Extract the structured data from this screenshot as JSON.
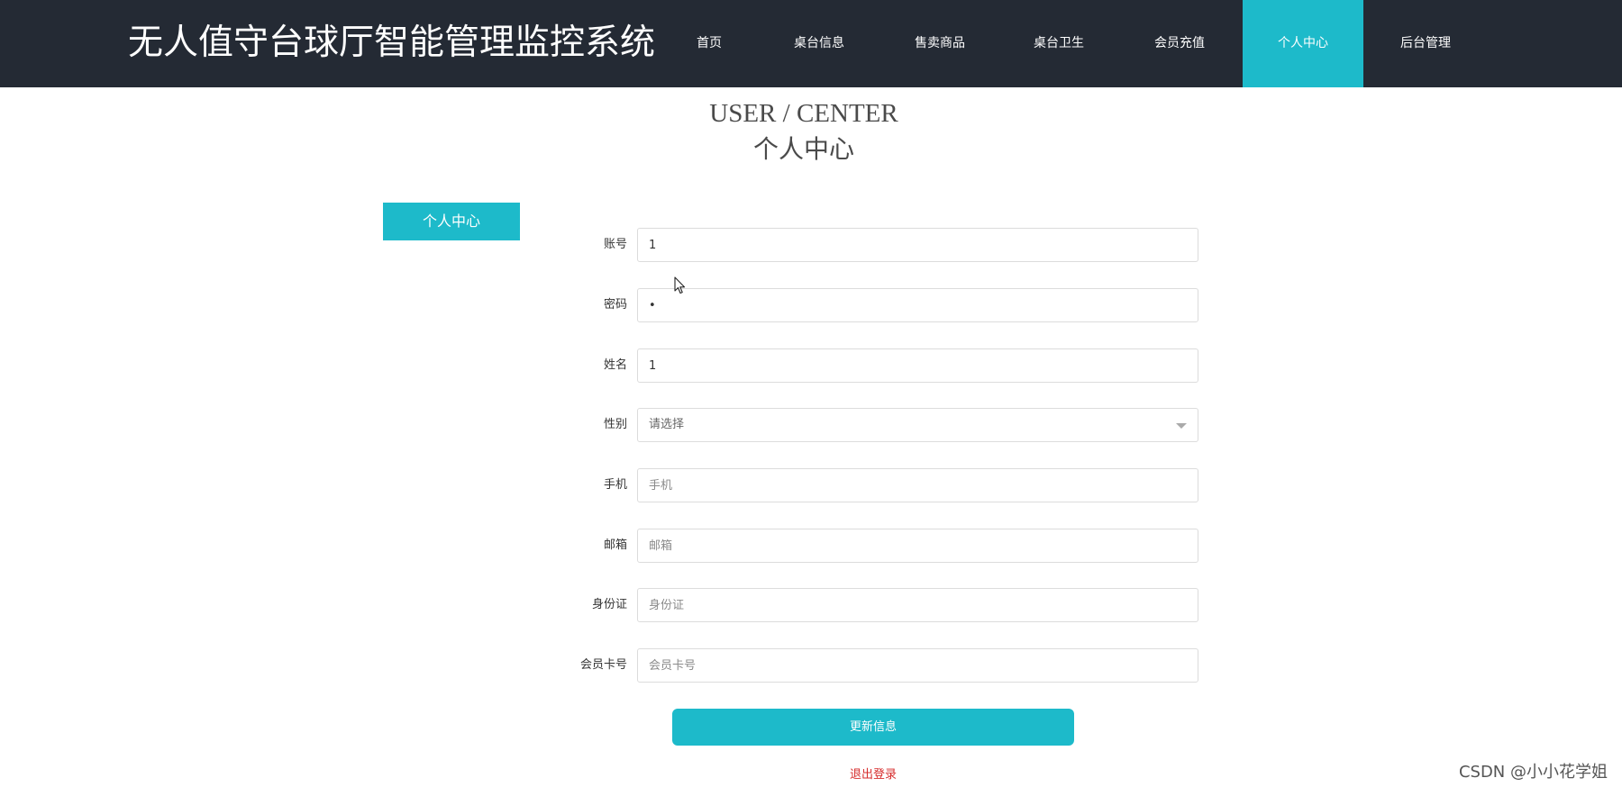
{
  "header": {
    "site_title": "无人值守台球厅智能管理监控系统",
    "nav": [
      {
        "label": "首页"
      },
      {
        "label": "桌台信息"
      },
      {
        "label": "售卖商品"
      },
      {
        "label": "桌台卫生"
      },
      {
        "label": "会员充值"
      },
      {
        "label": "个人中心"
      },
      {
        "label": "后台管理"
      }
    ],
    "active_nav": "个人中心",
    "accent_color": "#1dbaca",
    "bar_color": "#242a34"
  },
  "page": {
    "heading_en": "USER / CENTER",
    "heading_cn": "个人中心"
  },
  "sidebar": {
    "tab_label": "个人中心"
  },
  "form": {
    "account": {
      "label": "账号",
      "value": "1"
    },
    "password": {
      "label": "密码",
      "value": "•"
    },
    "name": {
      "label": "姓名",
      "value": "1"
    },
    "gender": {
      "label": "性别",
      "value": "请选择"
    },
    "phone": {
      "label": "手机",
      "placeholder": "手机"
    },
    "email": {
      "label": "邮箱",
      "placeholder": "邮箱"
    },
    "id_card": {
      "label": "身份证",
      "placeholder": "身份证"
    },
    "member_card": {
      "label": "会员卡号",
      "placeholder": "会员卡号"
    },
    "submit_label": "更新信息",
    "logout_label": "退出登录"
  },
  "watermark": "CSDN @小小花学姐"
}
